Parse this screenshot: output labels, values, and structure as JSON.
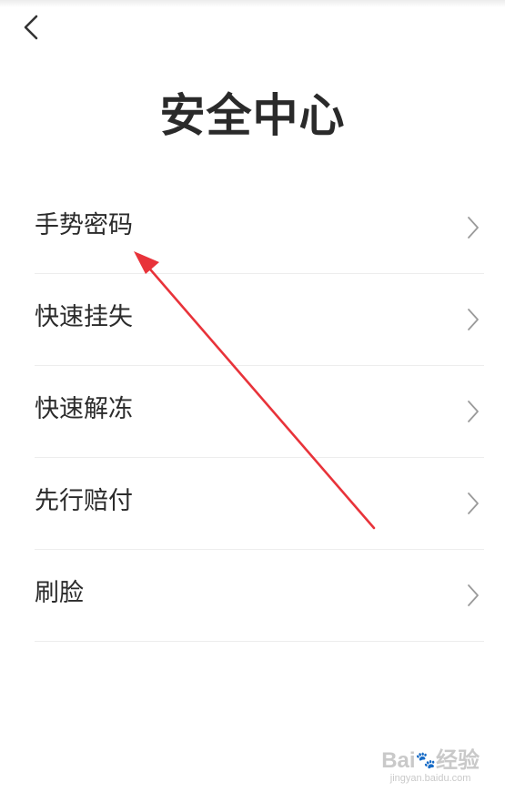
{
  "header": {
    "title": "安全中心"
  },
  "menu": {
    "items": [
      {
        "label": "手势密码"
      },
      {
        "label": "快速挂失"
      },
      {
        "label": "快速解冻"
      },
      {
        "label": "先行赔付"
      },
      {
        "label": "刷脸"
      }
    ]
  },
  "icons": {
    "back": "chevron-left-icon",
    "item_arrow": "chevron-right-icon"
  },
  "annotation": {
    "color": "#e8333a"
  },
  "watermark": {
    "logo_prefix": "Bai",
    "logo_suffix": "经验",
    "url": "jingyan.baidu.com"
  },
  "colors": {
    "background": "#ffffff",
    "text": "#2b2b2b",
    "divider": "#ededed",
    "chevron": "#9a9a9a"
  }
}
